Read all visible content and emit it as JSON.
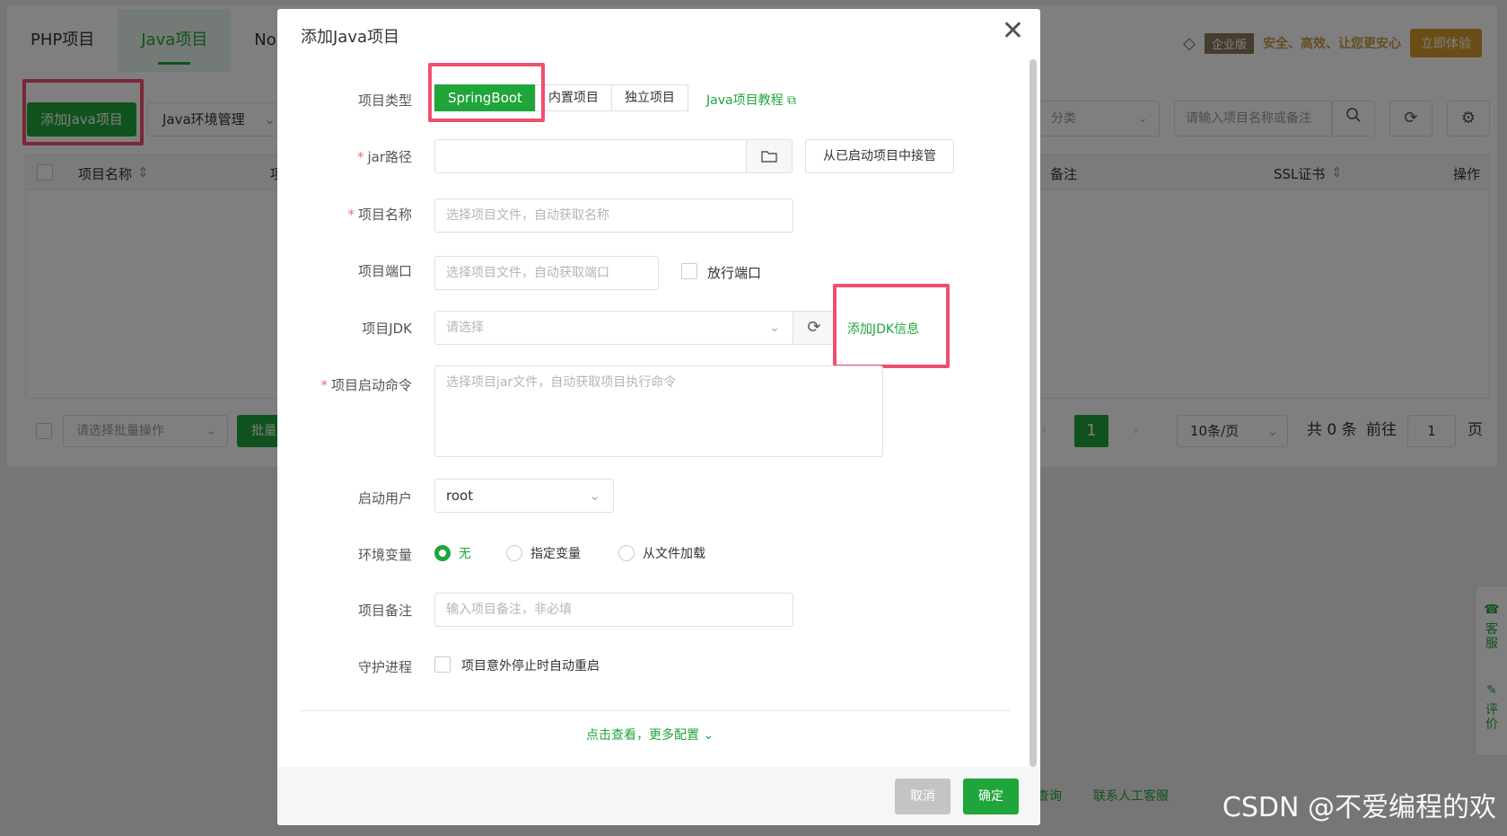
{
  "tabs": [
    "PHP项目",
    "Java项目",
    "No"
  ],
  "enterprise": {
    "badge": "企业版",
    "slogan": "安全、高效、让您更安心",
    "try": "立即体验"
  },
  "toolbar": {
    "add_java": "添加Java项目",
    "env_manage": "Java环境管理",
    "category": "分类",
    "search_placeholder": "请输入项目名称或备注"
  },
  "table": {
    "headers": [
      "项目名称",
      "项",
      "备注",
      "SSL证书",
      "操作"
    ]
  },
  "batch": {
    "select_placeholder": "请选择批量操作",
    "button": "批量"
  },
  "pager": {
    "current": "1",
    "page_size": "10条/页",
    "total": "共 0 条",
    "goto": "前往",
    "goto_value": "1",
    "page_unit": "页"
  },
  "side_float": {
    "service": "客服",
    "review": "评价"
  },
  "footer": {
    "query": "查询",
    "human_service": "联系人工客服"
  },
  "watermark": "CSDN @不爱编程的欢",
  "modal": {
    "title": "添加Java项目",
    "project_type": {
      "label": "项目类型",
      "options": [
        "SpringBoot",
        "内置项目",
        "独立项目"
      ],
      "selected": "SpringBoot",
      "tutorial": "Java项目教程"
    },
    "jar_path": {
      "label": "jar路径",
      "value": "",
      "takeover": "从已启动项目中接管"
    },
    "project_name": {
      "label": "项目名称",
      "placeholder": "选择项目文件，自动获取名称"
    },
    "project_port": {
      "label": "项目端口",
      "placeholder": "选择项目文件，自动获取端口",
      "release_port": "放行端口"
    },
    "project_jdk": {
      "label": "项目JDK",
      "placeholder": "请选择",
      "add_jdk": "添加JDK信息"
    },
    "start_cmd": {
      "label": "项目启动命令",
      "placeholder": "选择项目jar文件，自动获取项目执行命令"
    },
    "start_user": {
      "label": "启动用户",
      "value": "root"
    },
    "env_vars": {
      "label": "环境变量",
      "options": [
        "无",
        "指定变量",
        "从文件加载"
      ],
      "selected": "无"
    },
    "remark": {
      "label": "项目备注",
      "placeholder": "输入项目备注，非必填"
    },
    "daemon": {
      "label": "守护进程",
      "checkbox": "项目意外停止时自动重启"
    },
    "more": "点击查看，更多配置",
    "cancel": "取消",
    "confirm": "确定"
  },
  "colors": {
    "accent": "#20a53a",
    "highlight": "#f0506e",
    "overlay": "rgba(0,0,0,0.5)"
  }
}
